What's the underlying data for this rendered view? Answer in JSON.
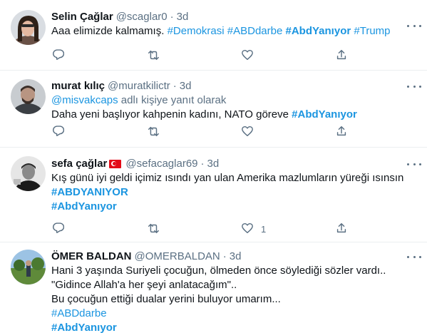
{
  "tweets": [
    {
      "name": "Selin Çağlar",
      "handle": "@scaglar0",
      "time": "3d",
      "lines": [
        {
          "segments": [
            {
              "t": "Aaa elimizde kalmamış. ",
              "k": "text"
            },
            {
              "t": "#Demokrasi",
              "k": "tag"
            },
            {
              "t": "  ",
              "k": "text"
            },
            {
              "t": "#ABDdarbe",
              "k": "tag"
            },
            {
              "t": "  ",
              "k": "text"
            },
            {
              "t": "#AbdYanıyor",
              "k": "tagb"
            },
            {
              "t": " ",
              "k": "text"
            },
            {
              "t": "#Trump",
              "k": "tag"
            }
          ]
        }
      ],
      "like_count": ""
    },
    {
      "name": "murat kılıç",
      "handle": "@muratkilictr",
      "time": "3d",
      "reply_to": {
        "user": "@misvakcaps",
        "suffix": " adlı kişiye yanıt olarak"
      },
      "lines": [
        {
          "segments": [
            {
              "t": "Daha yeni başlıyor kahpenin kadını, NATO göreve ",
              "k": "text"
            },
            {
              "t": "#AbdYanıyor",
              "k": "tagb"
            }
          ]
        }
      ],
      "like_count": ""
    },
    {
      "name": "sefa çağlar",
      "handle": "@sefacaglar69",
      "time": "3d",
      "lines": [
        {
          "segments": [
            {
              "t": "Kış günü iyi geldi içimiz ısındı yan ulan Amerika mazlumların yüreği ısınsın",
              "k": "text"
            }
          ]
        },
        {
          "segments": [
            {
              "t": " #ABDYANIYOR",
              "k": "tagb"
            }
          ]
        },
        {
          "segments": [
            {
              "t": "#AbdYanıyor",
              "k": "tagb"
            }
          ]
        }
      ],
      "like_count": "1"
    },
    {
      "name": "ÖMER BALDAN",
      "handle": "@OMERBALDAN",
      "time": "3d",
      "lines": [
        {
          "segments": [
            {
              "t": "Hani 3 yaşında Suriyeli çocuğun, ölmeden önce söylediği sözler vardı..",
              "k": "text"
            }
          ]
        },
        {
          "segments": [
            {
              "t": "\"Gidince Allah'a her şeyi anlatacağım\"..",
              "k": "text"
            }
          ]
        },
        {
          "segments": [
            {
              "t": "Bu çocuğun ettiği dualar yerini buluyor umarım...",
              "k": "text"
            }
          ]
        },
        {
          "segments": [
            {
              "t": "#ABDdarbe",
              "k": "tag"
            }
          ]
        },
        {
          "segments": [
            {
              "t": "#AbdYanıyor",
              "k": "tagb"
            }
          ]
        }
      ],
      "like_count": ""
    }
  ],
  "icons": {
    "reply": "reply-icon",
    "retweet": "retweet-icon",
    "like": "heart-icon",
    "share": "share-icon",
    "more": "more-options-icon"
  },
  "colors": {
    "link": "#1b95e0",
    "muted": "#5b7083",
    "text": "#0f1419",
    "divider": "#ebeef0"
  }
}
